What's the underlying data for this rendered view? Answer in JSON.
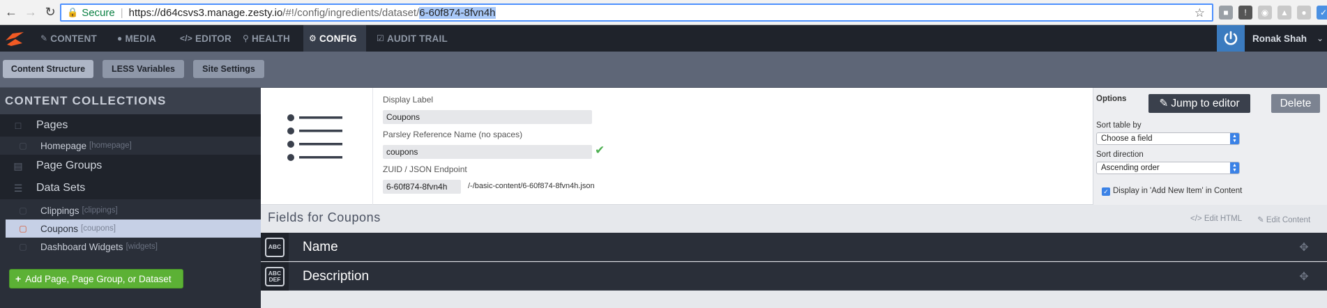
{
  "browser": {
    "secure_label": "Secure",
    "url_host": "https://d64csvs3.manage.zesty.io",
    "url_path": "/#!/config/ingredients/dataset/",
    "url_selected": "6-60f874-8fvn4h"
  },
  "header": {
    "nav": [
      {
        "label": "CONTENT",
        "icon": "edit-icon"
      },
      {
        "label": "MEDIA",
        "icon": "media-icon"
      },
      {
        "label": "EDITOR",
        "icon": "code-icon"
      },
      {
        "label": "HEALTH",
        "icon": "search-icon"
      },
      {
        "label": "CONFIG",
        "icon": "cogs-icon",
        "active": true
      },
      {
        "label": "AUDIT TRAIL",
        "icon": "check-square-icon"
      }
    ],
    "user_name": "Ronak Shah"
  },
  "subnav": {
    "tabs": [
      {
        "label": "Content Structure",
        "active": true
      },
      {
        "label": "LESS Variables"
      },
      {
        "label": "Site Settings"
      }
    ]
  },
  "sidebar": {
    "title": "CONTENT COLLECTIONS",
    "sections": [
      {
        "label": "Pages",
        "icon": "file-icon"
      },
      {
        "label": "Page Groups",
        "icon": "folder-icon"
      },
      {
        "label": "Data Sets",
        "icon": "list-icon"
      }
    ],
    "items": [
      {
        "label": "Homepage",
        "key": "[homepage]"
      },
      {
        "label": "Clippings",
        "key": "[clippings]"
      },
      {
        "label": "Coupons",
        "key": "[coupons]",
        "active": true
      },
      {
        "label": "Dashboard Widgets",
        "key": "[widgets]"
      }
    ],
    "add_button": "Add Page, Page Group, or Dataset"
  },
  "info": {
    "display_label_caption": "Display Label",
    "display_label_value": "Coupons",
    "parsley_caption": "Parsley Reference Name (no spaces)",
    "parsley_value": "coupons",
    "zuid_caption": "ZUID / JSON Endpoint",
    "zuid_value": "6-60f874-8fvn4h",
    "endpoint": "/-/basic-content/6-60f874-8fvn4h.json"
  },
  "options": {
    "title": "Options",
    "jump_button": "Jump to editor",
    "delete_button": "Delete",
    "sort_by_label": "Sort table by",
    "sort_by_value": "Choose a field",
    "sort_dir_label": "Sort direction",
    "sort_dir_value": "Ascending order",
    "display_checkbox_label": "Display in 'Add New Item' in Content",
    "display_checkbox_checked": true
  },
  "fields": {
    "heading": "Fields for Coupons",
    "edit_html": "Edit HTML",
    "edit_content": "Edit Content",
    "rows": [
      {
        "name": "Name",
        "type_icon": [
          "ABC"
        ]
      },
      {
        "name": "Description",
        "type_icon": [
          "ABC",
          "DEF"
        ]
      }
    ]
  }
}
